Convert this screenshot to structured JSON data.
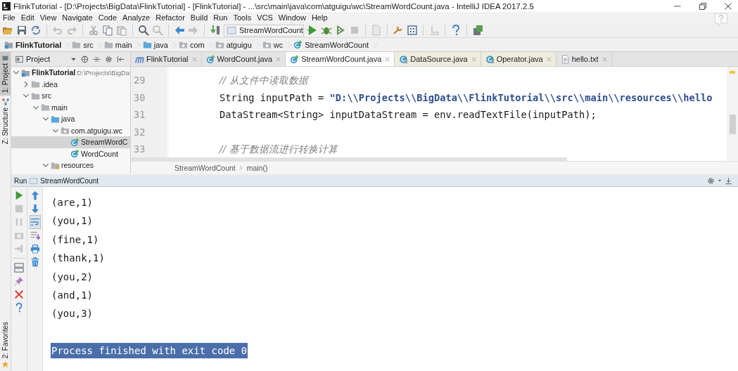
{
  "window": {
    "title": "FlinkTutorial - [D:\\Projects\\BigData\\FlinkTutorial] - [FlinkTutorial] - ...\\src\\main\\java\\com\\atguigu\\wc\\StreamWordCount.java - IntelliJ IDEA 2017.2.5"
  },
  "menu": [
    "File",
    "Edit",
    "View",
    "Navigate",
    "Code",
    "Analyze",
    "Refactor",
    "Build",
    "Run",
    "Tools",
    "VCS",
    "Window",
    "Help"
  ],
  "toolbar": {
    "run_config": "StreamWordCount"
  },
  "navigation_bar": [
    {
      "label": "FlinkTutorial",
      "kind": "project"
    },
    {
      "label": "src",
      "kind": "folder"
    },
    {
      "label": "main",
      "kind": "folder"
    },
    {
      "label": "java",
      "kind": "source"
    },
    {
      "label": "com",
      "kind": "package"
    },
    {
      "label": "atguigu",
      "kind": "package"
    },
    {
      "label": "wc",
      "kind": "package"
    },
    {
      "label": "StreamWordCount",
      "kind": "class"
    }
  ],
  "tool_windows": [
    {
      "label": "1: Project",
      "selected": true,
      "kind": "project"
    },
    {
      "label": "Z: Structure",
      "selected": false,
      "kind": "structure"
    },
    {
      "label": "2: Favorites",
      "selected": false,
      "kind": "favorites"
    }
  ],
  "project_panel": {
    "title": "Project",
    "tree": [
      {
        "label": "FlinkTutorial",
        "path": "D:\\Projects\\BigDa",
        "kind": "module",
        "expanded": true,
        "selected": false,
        "children": [
          {
            "label": ".idea",
            "kind": "folder",
            "expanded": false,
            "selected": false
          },
          {
            "label": "src",
            "kind": "folder",
            "expanded": true,
            "selected": false,
            "children": [
              {
                "label": "main",
                "kind": "folder",
                "expanded": true,
                "selected": false,
                "children": [
                  {
                    "label": "java",
                    "kind": "source",
                    "expanded": true,
                    "selected": false,
                    "children": [
                      {
                        "label": "com.atguigu.wc",
                        "kind": "package",
                        "expanded": true,
                        "selected": false,
                        "children": [
                          {
                            "label": "StreamWordC",
                            "kind": "class",
                            "selected": true
                          },
                          {
                            "label": "WordCount",
                            "kind": "class",
                            "selected": false
                          }
                        ]
                      }
                    ]
                  },
                  {
                    "label": "resources",
                    "kind": "resources",
                    "expanded": true,
                    "selected": false
                  }
                ]
              }
            ]
          }
        ]
      }
    ]
  },
  "editor_tabs": [
    {
      "label": "FlinkTutorial",
      "kind": "maven",
      "selected": false
    },
    {
      "label": "WordCount.java",
      "kind": "class",
      "selected": false
    },
    {
      "label": "StreamWordCount.java",
      "kind": "class",
      "selected": true
    },
    {
      "label": "DataSource.java",
      "kind": "abstract",
      "selected": false
    },
    {
      "label": "Operator.java",
      "kind": "abstract",
      "selected": false
    },
    {
      "label": "hello.txt",
      "kind": "text",
      "selected": false
    }
  ],
  "code_lines": [
    {
      "number": "29",
      "parts": [
        {
          "text": "// 从文件中读取数据",
          "kind": "comment"
        }
      ]
    },
    {
      "number": "30",
      "parts": [
        {
          "text": "String inputPath = ",
          "kind": "plain"
        },
        {
          "text": "\"D:\\\\Projects\\\\BigData\\\\FlinkTutorial\\\\src\\\\main\\\\resources\\\\hello",
          "kind": "string"
        }
      ]
    },
    {
      "number": "31",
      "parts": [
        {
          "text": "DataStream<String> inputDataStream = env.readTextFile(inputPath);",
          "kind": "plain"
        }
      ]
    },
    {
      "number": "32"
    },
    {
      "number": "33",
      "parts": [
        {
          "text": "// 基于数据流进行转换计算",
          "kind": "comment"
        }
      ]
    }
  ],
  "editor_breadcrumb": [
    "StreamWordCount",
    "main()"
  ],
  "run_panel": {
    "title": "Run",
    "config": "StreamWordCount",
    "output": [
      "(are,1)",
      "(you,1)",
      "(fine,1)",
      "(thank,1)",
      "(you,2)",
      "(and,1)",
      "(you,3)"
    ],
    "exit_message": {
      "text": "Process finished with exit code 0",
      "selected": true
    }
  }
}
